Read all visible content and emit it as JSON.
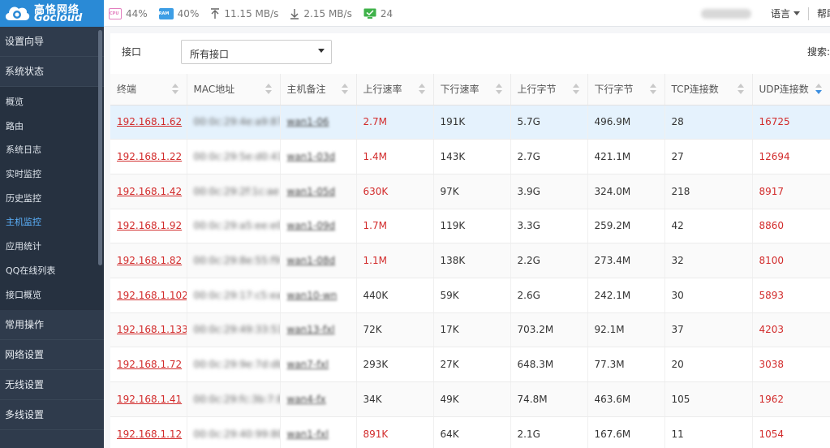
{
  "brand": {
    "name_cn": "高恪网络",
    "name_en": "Gocloud"
  },
  "stats": {
    "cpu_badge": "CPU",
    "cpu": "44%",
    "ram_badge": "RAM",
    "ram": "40%",
    "upload": "11.15 MB/s",
    "download": "2.15 MB/s",
    "online": "24"
  },
  "topright": {
    "language": "语言",
    "help": "帮助"
  },
  "sidebar": {
    "top": [
      {
        "label": "设置向导"
      },
      {
        "label": "系统状态"
      }
    ],
    "items": [
      {
        "label": "概览"
      },
      {
        "label": "路由"
      },
      {
        "label": "系统日志"
      },
      {
        "label": "实时监控"
      },
      {
        "label": "历史监控"
      },
      {
        "label": "主机监控"
      },
      {
        "label": "应用统计"
      },
      {
        "label": "QQ在线列表"
      },
      {
        "label": "接口概览"
      }
    ],
    "bottom": [
      {
        "label": "常用操作"
      },
      {
        "label": "网络设置"
      },
      {
        "label": "无线设置"
      },
      {
        "label": "多线设置"
      }
    ]
  },
  "filter": {
    "label": "接口",
    "value": "所有接口",
    "search_label": "搜索:"
  },
  "table": {
    "headers": [
      "终端",
      "MAC地址",
      "主机备注",
      "上行速率",
      "下行速率",
      "上行字节",
      "下行字节",
      "TCP连接数",
      "UDP连接数"
    ],
    "rows": [
      {
        "ip": "192.168.1.62",
        "mac": "00:0c:29:4e:a9:87",
        "host": "wan1-06",
        "up": "2.7M",
        "down": "191K",
        "up_bytes": "5.7G",
        "down_bytes": "496.9M",
        "tcp": "28",
        "udp": "16725"
      },
      {
        "ip": "192.168.1.22",
        "mac": "00:0c:29:5e:d0:41",
        "host": "wan1-03d",
        "up": "1.4M",
        "down": "143K",
        "up_bytes": "2.7G",
        "down_bytes": "421.1M",
        "tcp": "27",
        "udp": "12694"
      },
      {
        "ip": "192.168.1.42",
        "mac": "00:0c:29:2f:1c:ae",
        "host": "wan1-05d",
        "up": "630K",
        "down": "97K",
        "up_bytes": "3.9G",
        "down_bytes": "324.0M",
        "tcp": "218",
        "udp": "8917"
      },
      {
        "ip": "192.168.1.92",
        "mac": "00:0c:29:a5:ee:e0",
        "host": "wan1-09d",
        "up": "1.7M",
        "down": "119K",
        "up_bytes": "3.3G",
        "down_bytes": "259.2M",
        "tcp": "42",
        "udp": "8860"
      },
      {
        "ip": "192.168.1.82",
        "mac": "00:0c:29:8e:55:f9",
        "host": "wan1-08d",
        "up": "1.1M",
        "down": "138K",
        "up_bytes": "2.2G",
        "down_bytes": "273.4M",
        "tcp": "32",
        "udp": "8100"
      },
      {
        "ip": "192.168.1.102",
        "mac": "00:0c:29:17:c5:ea",
        "host": "wan10-wn",
        "up": "440K",
        "down": "59K",
        "up_bytes": "2.6G",
        "down_bytes": "242.1M",
        "tcp": "30",
        "udp": "5893"
      },
      {
        "ip": "192.168.1.133",
        "mac": "00:0c:29:49:33:51",
        "host": "wan13-fxl",
        "up": "72K",
        "down": "17K",
        "up_bytes": "703.2M",
        "down_bytes": "92.1M",
        "tcp": "37",
        "udp": "4203"
      },
      {
        "ip": "192.168.1.72",
        "mac": "00:0c:29:9e:7d:db",
        "host": "wan7-fxl",
        "up": "293K",
        "down": "27K",
        "up_bytes": "648.3M",
        "down_bytes": "77.3M",
        "tcp": "20",
        "udp": "3038"
      },
      {
        "ip": "192.168.1.41",
        "mac": "00:0c:29:fc:3b:7:8",
        "host": "wan4-fx",
        "up": "34K",
        "down": "49K",
        "up_bytes": "74.8M",
        "down_bytes": "463.6M",
        "tcp": "105",
        "udp": "1962"
      },
      {
        "ip": "192.168.1.12",
        "mac": "00:0c:29:40:99:80",
        "host": "wan1-fxl",
        "up": "891K",
        "down": "64K",
        "up_bytes": "2.1G",
        "down_bytes": "167.6M",
        "tcp": "11",
        "udp": "1054"
      }
    ]
  }
}
